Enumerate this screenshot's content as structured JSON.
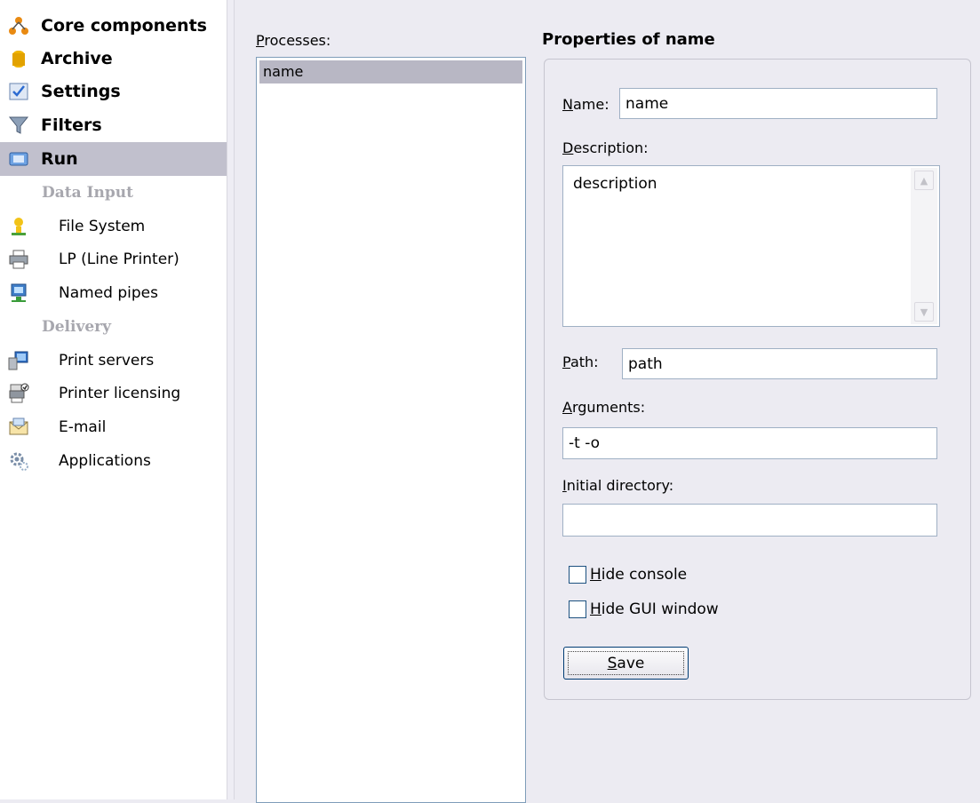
{
  "sidebar": {
    "items": [
      {
        "label": "Core components",
        "icon": "core-components-icon"
      },
      {
        "label": "Archive",
        "icon": "archive-icon"
      },
      {
        "label": "Settings",
        "icon": "settings-icon"
      },
      {
        "label": "Filters",
        "icon": "filter-icon"
      },
      {
        "label": "Run",
        "icon": "run-icon"
      }
    ],
    "selected": "Run",
    "sections": [
      {
        "title": "Data Input",
        "items": [
          {
            "label": "File System",
            "icon": "file-system-icon"
          },
          {
            "label": "LP (Line Printer)",
            "icon": "line-printer-icon"
          },
          {
            "label": "Named pipes",
            "icon": "named-pipes-icon"
          }
        ]
      },
      {
        "title": "Delivery",
        "items": [
          {
            "label": "Print servers",
            "icon": "print-servers-icon"
          },
          {
            "label": "Printer licensing",
            "icon": "printer-licensing-icon"
          },
          {
            "label": "E-mail",
            "icon": "email-icon"
          },
          {
            "label": "Applications",
            "icon": "applications-icon"
          }
        ]
      }
    ]
  },
  "processes": {
    "label_prefix": "P",
    "label_rest": "rocesses:",
    "items": [
      "name"
    ],
    "selected": "name"
  },
  "properties": {
    "title": "Properties of name",
    "name_label_key": "N",
    "name_label_rest": "ame:",
    "name_value": "name",
    "description_label_key": "D",
    "description_label_rest": "escription:",
    "description_value": "description",
    "path_label_key": "P",
    "path_label_rest": "ath:",
    "path_value": "path",
    "arguments_label_key": "A",
    "arguments_label_rest": "rguments:",
    "arguments_value": "-t -o",
    "initial_dir_label_key": "I",
    "initial_dir_label_rest": "nitial directory:",
    "initial_dir_value": "",
    "hide_console_key": "H",
    "hide_console_rest": "ide console",
    "hide_console_checked": false,
    "hide_gui_key": "H",
    "hide_gui_rest": "ide GUI window",
    "hide_gui_checked": false,
    "save_key": "S",
    "save_rest": "ave"
  },
  "colors": {
    "selection": "#c1c0cd",
    "panel_bg": "#ecebf2",
    "input_border": "#9fb0c4"
  }
}
